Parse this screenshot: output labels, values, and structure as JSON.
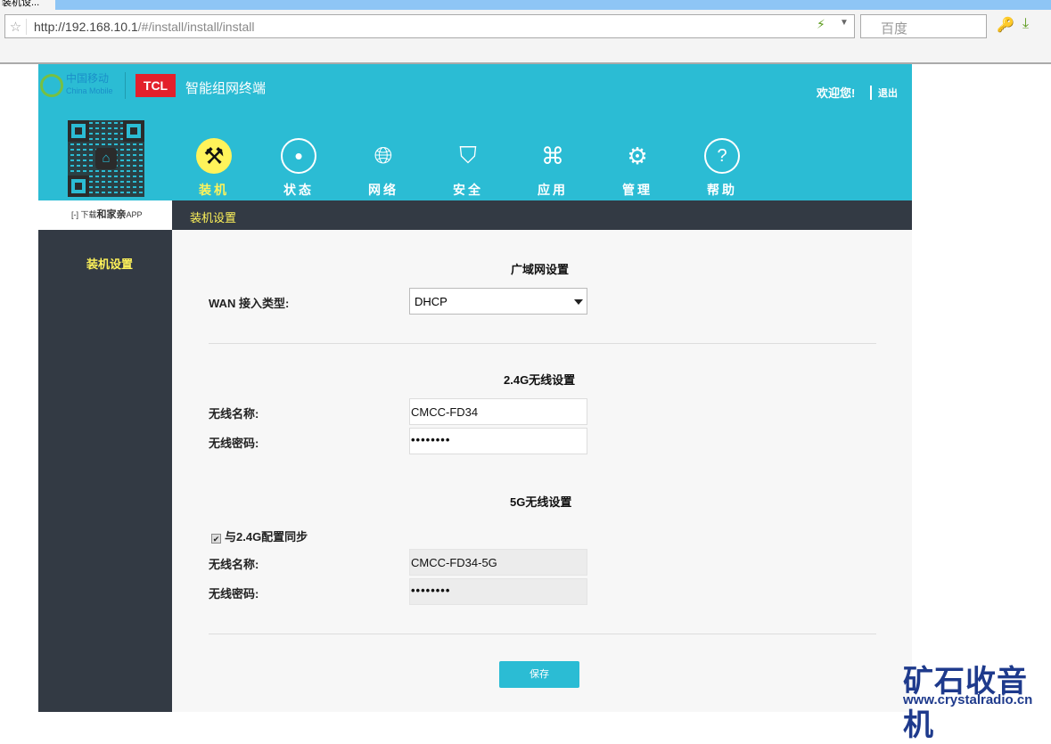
{
  "browser": {
    "tab_title": "装机设...",
    "url_host": "http://192.168.10.1",
    "url_path": "/#/install/install/install",
    "search_engine": "百度"
  },
  "header": {
    "brand_cn": "中国移动",
    "brand_en": "China Mobile",
    "tcl": "TCL",
    "product": "智能组网终端",
    "welcome": "欢迎您!",
    "logout": "退出",
    "qr_label_pre": "下载",
    "qr_label_app": "和家亲",
    "qr_label_post": "APP"
  },
  "nav": [
    {
      "label": "装机",
      "icon": "tools-icon"
    },
    {
      "label": "状态",
      "icon": "target-icon"
    },
    {
      "label": "网络",
      "icon": "globe-icon"
    },
    {
      "label": "安全",
      "icon": "shield-icon"
    },
    {
      "label": "应用",
      "icon": "apps-icon"
    },
    {
      "label": "管理",
      "icon": "gear-icon"
    },
    {
      "label": "帮助",
      "icon": "help-icon"
    }
  ],
  "subnav": {
    "title": "装机设置"
  },
  "sidebar": {
    "item": "装机设置"
  },
  "wan": {
    "title": "广域网设置",
    "label": "WAN 接入类型:",
    "value": "DHCP"
  },
  "wifi24": {
    "title": "2.4G无线设置",
    "ssid_label": "无线名称:",
    "ssid": "CMCC-FD34",
    "pw_label": "无线密码:",
    "pw": "••••••••"
  },
  "wifi5": {
    "title": "5G无线设置",
    "sync_label": "与2.4G配置同步",
    "sync_checked": true,
    "ssid_label": "无线名称:",
    "ssid": "CMCC-FD34-5G",
    "pw_label": "无线密码:",
    "pw": "••••••••"
  },
  "save_label": "保存",
  "watermark": {
    "cn": "矿石收音机",
    "url": "www.crystalradio.cn"
  },
  "colors": {
    "teal": "#2bbcd4",
    "dark": "#333a44",
    "yellow": "#fff35a"
  }
}
